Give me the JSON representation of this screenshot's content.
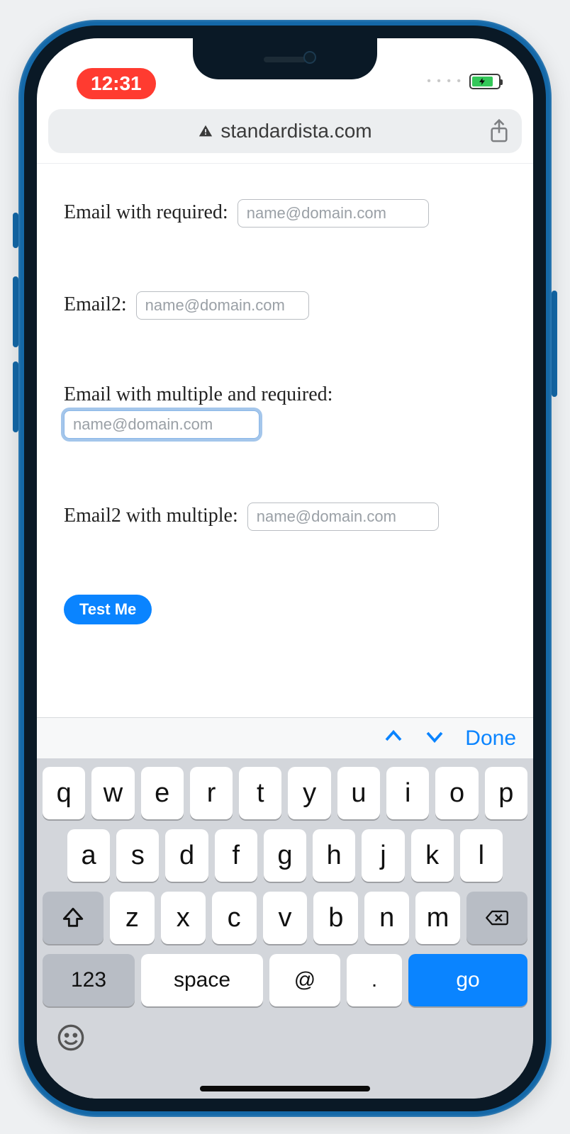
{
  "statusbar": {
    "time": "12:31"
  },
  "urlbar": {
    "domain": "standardista.com"
  },
  "form": {
    "field1": {
      "label": "Email with required: ",
      "placeholder": "name@domain.com"
    },
    "field2": {
      "label": "Email2: ",
      "placeholder": "name@domain.com"
    },
    "field3": {
      "label": "Email with multiple and required:",
      "placeholder": "name@domain.com"
    },
    "field4": {
      "label": "Email2 with multiple: ",
      "placeholder": "name@domain.com"
    },
    "submit_label": "Test Me"
  },
  "keyboard_accessory": {
    "done_label": "Done"
  },
  "keyboard": {
    "row1": [
      "q",
      "w",
      "e",
      "r",
      "t",
      "y",
      "u",
      "i",
      "o",
      "p"
    ],
    "row2": [
      "a",
      "s",
      "d",
      "f",
      "g",
      "h",
      "j",
      "k",
      "l"
    ],
    "row3": [
      "z",
      "x",
      "c",
      "v",
      "b",
      "n",
      "m"
    ],
    "numbers_label": "123",
    "space_label": "space",
    "at_label": "@",
    "dot_label": ".",
    "go_label": "go"
  }
}
